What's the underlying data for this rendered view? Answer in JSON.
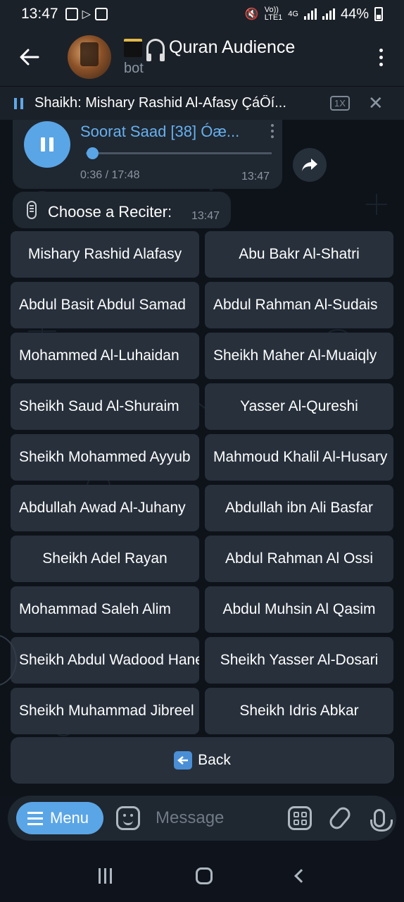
{
  "status_bar": {
    "time": "13:47",
    "net_vo": "Vo))",
    "net_lte": "LTE1",
    "net_4g": "4G",
    "battery": "44%"
  },
  "header": {
    "title": "Quran Audience",
    "subtitle": "bot"
  },
  "player": {
    "text": "Shaikh: Mishary Rashid Al-Afasy  ÇáÔí...",
    "speed": "1X"
  },
  "audio_message": {
    "title": "Soorat Saad [38] Óæ...",
    "duration": "0:36 / 17:48",
    "time": "13:47",
    "progress": 0.034
  },
  "reciter_message": {
    "text": "Choose a Reciter:",
    "time": "13:47"
  },
  "buttons": [
    {
      "label": "Mishary Rashid Alafasy",
      "clip": false
    },
    {
      "label": "Abu Bakr Al-Shatri",
      "clip": false
    },
    {
      "label": "Abdul Basit Abdul Samad",
      "clip": true
    },
    {
      "label": "Abdul Rahman Al-Sudais",
      "clip": true
    },
    {
      "label": "Mohammed Al-Luhaidan",
      "clip": true
    },
    {
      "label": "Sheikh Maher Al-Muaiqly",
      "clip": true
    },
    {
      "label": "Sheikh Saud Al-Shuraim",
      "clip": true
    },
    {
      "label": "Yasser Al-Qureshi",
      "clip": false
    },
    {
      "label": "Sheikh Mohammed Ayyub",
      "clip": true
    },
    {
      "label": "Mahmoud Khalil Al-Husary",
      "clip": true
    },
    {
      "label": "Abdullah Awad Al-Juhany",
      "clip": true
    },
    {
      "label": "Abdullah ibn Ali Basfar",
      "clip": false
    },
    {
      "label": "Sheikh Adel Rayan",
      "clip": false
    },
    {
      "label": "Abdul Rahman Al Ossi",
      "clip": false
    },
    {
      "label": "Mohammad Saleh Alim",
      "clip": true
    },
    {
      "label": "Abdul Muhsin Al Qasim",
      "clip": false
    },
    {
      "label": "Sheikh Abdul Wadood Haneef",
      "clip": true
    },
    {
      "label": "Sheikh Yasser Al-Dosari",
      "clip": false
    },
    {
      "label": "Sheikh Muhammad Jibreel",
      "clip": true
    },
    {
      "label": "Sheikh Idris Abkar",
      "clip": false
    }
  ],
  "back_button": {
    "label": "Back"
  },
  "input_bar": {
    "menu_label": "Menu",
    "placeholder": "Message"
  },
  "colors": {
    "accent": "#5aa5e6",
    "button_bg": "#27303b",
    "chat_bg": "#0e131a"
  }
}
